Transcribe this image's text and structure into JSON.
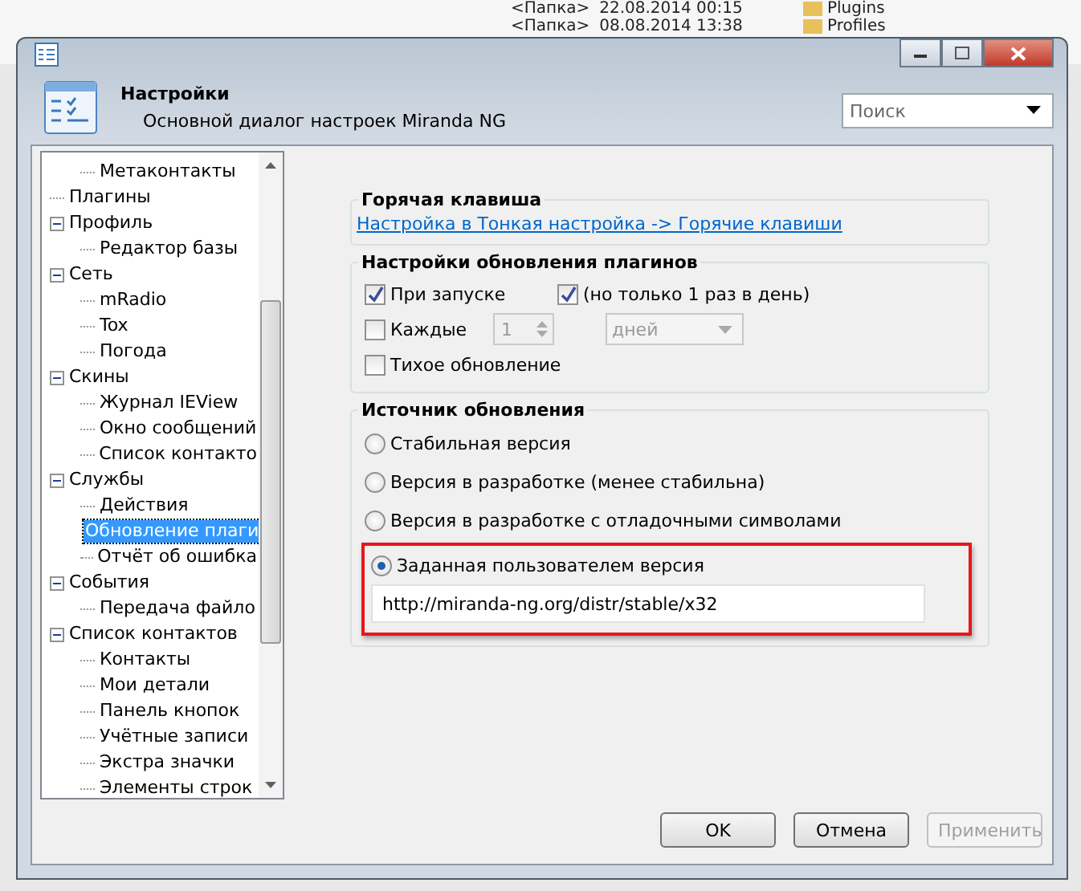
{
  "background": {
    "rows": [
      {
        "type": "<Папка>",
        "date": "22.08.2014 00:15"
      },
      {
        "type": "<Папка>",
        "date": "08.08.2014 13:38"
      }
    ],
    "folders": [
      "Plugins",
      "Profiles"
    ]
  },
  "window": {
    "title": "Настройки",
    "subtitle": "Основной диалог настроек Miranda NG"
  },
  "search": {
    "placeholder": "Поиск"
  },
  "tree": [
    {
      "children": [
        {
          "label": "Метаконтакты",
          "selected": false
        }
      ]
    },
    {
      "label": "Плагины",
      "selected": false
    },
    {
      "label": "Профиль",
      "selected": false,
      "expanded": true,
      "children": [
        {
          "label": "Редактор базы",
          "selected": false
        }
      ]
    },
    {
      "label": "Сеть",
      "selected": false,
      "expanded": true,
      "children": [
        {
          "label": "mRadio",
          "selected": false
        },
        {
          "label": "Tox",
          "selected": false
        },
        {
          "label": "Погода",
          "selected": false
        }
      ]
    },
    {
      "label": "Скины",
      "selected": false,
      "expanded": true,
      "children": [
        {
          "label": "Журнал IEView",
          "selected": false
        },
        {
          "label": "Окно сообщений",
          "selected": false
        },
        {
          "label": "Список контакто",
          "selected": false
        }
      ]
    },
    {
      "label": "Службы",
      "selected": false,
      "expanded": true,
      "children": [
        {
          "label": "Действия",
          "selected": false
        },
        {
          "label": "Обновление плаги",
          "selected": true
        },
        {
          "label": "Отчёт об ошибка",
          "selected": false
        }
      ]
    },
    {
      "label": "События",
      "selected": false,
      "expanded": true,
      "children": [
        {
          "label": "Передача файло",
          "selected": false
        }
      ]
    },
    {
      "label": "Список контактов",
      "selected": false,
      "expanded": true,
      "children": [
        {
          "label": "Контакты",
          "selected": false
        },
        {
          "label": "Мои детали",
          "selected": false
        },
        {
          "label": "Панель кнопок",
          "selected": false
        },
        {
          "label": "Учётные записи",
          "selected": false
        },
        {
          "label": "Экстра значки",
          "selected": false
        },
        {
          "label": "Элементы строк",
          "selected": false
        }
      ]
    }
  ],
  "hotkey": {
    "title": "Горячая клавиша",
    "link": "Настройка в Тонкая настройка -> Горячие клавиши"
  },
  "update_settings": {
    "title": "Настройки обновления плагинов",
    "on_startup": {
      "label": "При запуске",
      "checked": true
    },
    "once_a_day": {
      "label": "(но только 1 раз в день)",
      "checked": true
    },
    "every": {
      "label": "Каждые",
      "checked": false,
      "value": "1",
      "unit": "дней"
    },
    "silent": {
      "label": "Тихое обновление",
      "checked": false
    }
  },
  "source": {
    "title": "Источник обновления",
    "options": [
      {
        "label": "Стабильная версия",
        "selected": false
      },
      {
        "label": "Версия в разработке (менее стабильна)",
        "selected": false
      },
      {
        "label": "Версия в разработке с отладочными символами",
        "selected": false
      },
      {
        "label": "Заданная пользователем версия",
        "selected": true
      }
    ],
    "url": "http://miranda-ng.org/distr/stable/x32"
  },
  "buttons": [
    {
      "label": "OK",
      "disabled": false
    },
    {
      "label": "Отмена",
      "disabled": false
    },
    {
      "label": "Применить",
      "disabled": true
    }
  ]
}
